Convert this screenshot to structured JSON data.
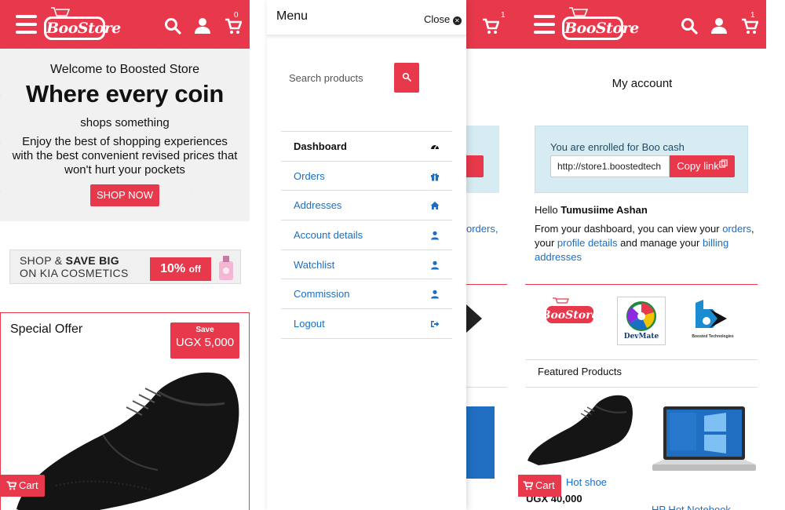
{
  "brand": {
    "name": "BooStore",
    "accent": "#e8394c"
  },
  "left_panel": {
    "cart_count": "0",
    "hero": {
      "welcome": "Welcome to Boosted Store",
      "headline": "Where every coin",
      "subheadline": "shops something",
      "description": "Enjoy the best of shopping experiences with the best convenient revised prices that won't hurt your pockets",
      "cta": "SHOP NOW"
    },
    "banner": {
      "line1_pre": "SHOP &",
      "line1_bold": "SAVE BIG",
      "line2": "ON KIA COSMETICS",
      "discount": "10%",
      "discount_suffix": "off"
    },
    "special_offer": {
      "title": "Special Offer",
      "save_label": "Save",
      "save_amount": "UGX 5,000",
      "cart_label": "Cart"
    }
  },
  "menu": {
    "title": "Menu",
    "close_label": "Close",
    "search_placeholder": "Search products",
    "items": [
      {
        "label": "Dashboard",
        "icon": "dashboard-icon",
        "active": true
      },
      {
        "label": "Orders",
        "icon": "gift-icon"
      },
      {
        "label": "Addresses",
        "icon": "home-icon"
      },
      {
        "label": "Account details",
        "icon": "user-icon"
      },
      {
        "label": "Watchlist",
        "icon": "user-icon"
      },
      {
        "label": "Commission",
        "icon": "user-icon"
      },
      {
        "label": "Logout",
        "icon": "sign-out-icon"
      }
    ],
    "behind_cart_count": "1",
    "behind_text": "orders,"
  },
  "right_panel": {
    "cart_count": "1",
    "title": "My account",
    "enroll_text": "You are enrolled for Boo cash",
    "referral_link": "http://store1.boostedtech",
    "copy_label": "Copy link",
    "hello_prefix": "Hello",
    "user_name": "Tumusiime Ashan",
    "dash_text_1": "From your dashboard, you can view your",
    "dash_link_orders": "orders",
    "dash_text_2": ", your",
    "dash_link_profile": "profile details",
    "dash_text_3": "and manage your",
    "dash_link_billing": "billing addresses",
    "partners": [
      "BooStore",
      "DevMate",
      "Boosted Technologies"
    ],
    "featured_title": "Featured Products",
    "product1": {
      "name": "Hot shoe",
      "price": "UGX 40,000",
      "cart_label": "Cart"
    },
    "product2_name": "HP Hot Notebook"
  }
}
